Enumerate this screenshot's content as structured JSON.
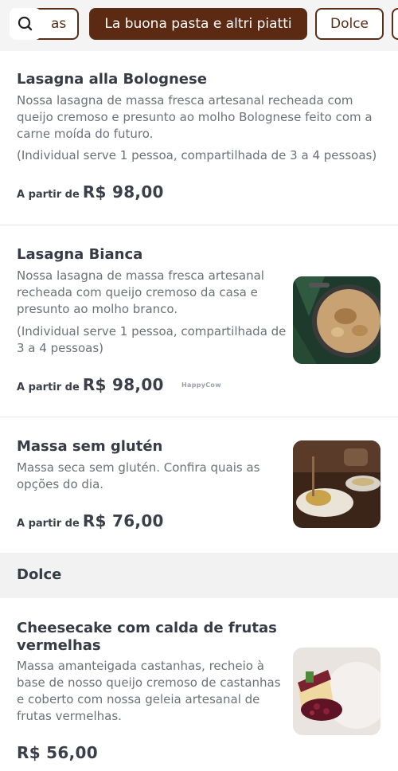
{
  "category_bar": {
    "tabs": [
      {
        "label": "as",
        "active": false
      },
      {
        "label": "La buona pasta e altri piatti",
        "active": true
      },
      {
        "label": "Dolce",
        "active": false
      }
    ]
  },
  "items": [
    {
      "title": "Lasagna alla Bolognese",
      "description": [
        "Nossa lasagna de massa fresca artesanal recheada com",
        "queijo cremoso e presunto ao molho Bolognese feito com a",
        "carne moída do futuro."
      ],
      "note": "(Individual serve 1 pessoa, compartilhada de 3 a 4 pessoas)",
      "price_prefix": "A partir de",
      "price": "R$ 98,00"
    },
    {
      "title": "Lasagna Bianca",
      "description": [
        "Nossa lasagna de massa fresca artesanal",
        "recheada com queijo cremoso da casa e",
        "presunto ao molho branco."
      ],
      "note": [
        "(Individual serve 1 pessoa, compartilhada de",
        "3 a 4 pessoas)"
      ],
      "price_prefix": "A partir de",
      "price": "R$ 98,00",
      "watermark": "HappyCow"
    },
    {
      "title": "Massa sem glutén",
      "description": [
        "Massa seca sem glutén. Confira quais as",
        "opções do dia."
      ],
      "price_prefix": "A partir de",
      "price": "R$ 76,00"
    }
  ],
  "section": {
    "title": "Dolce"
  },
  "dolce_items": [
    {
      "title": [
        "Cheesecake com calda de frutas",
        "vermelhas"
      ],
      "description": [
        "Massa amanteigada castanhas, recheio à",
        "base de nosso queijo cremoso de castanhas",
        "e coberto com nossa geleia artesanal de",
        "frutas vermelhas."
      ],
      "price": "R$ 56,00"
    }
  ],
  "icons": {
    "search": "search-icon"
  },
  "colors": {
    "brand": "#5c2a12",
    "background": "#f4f4f5"
  }
}
